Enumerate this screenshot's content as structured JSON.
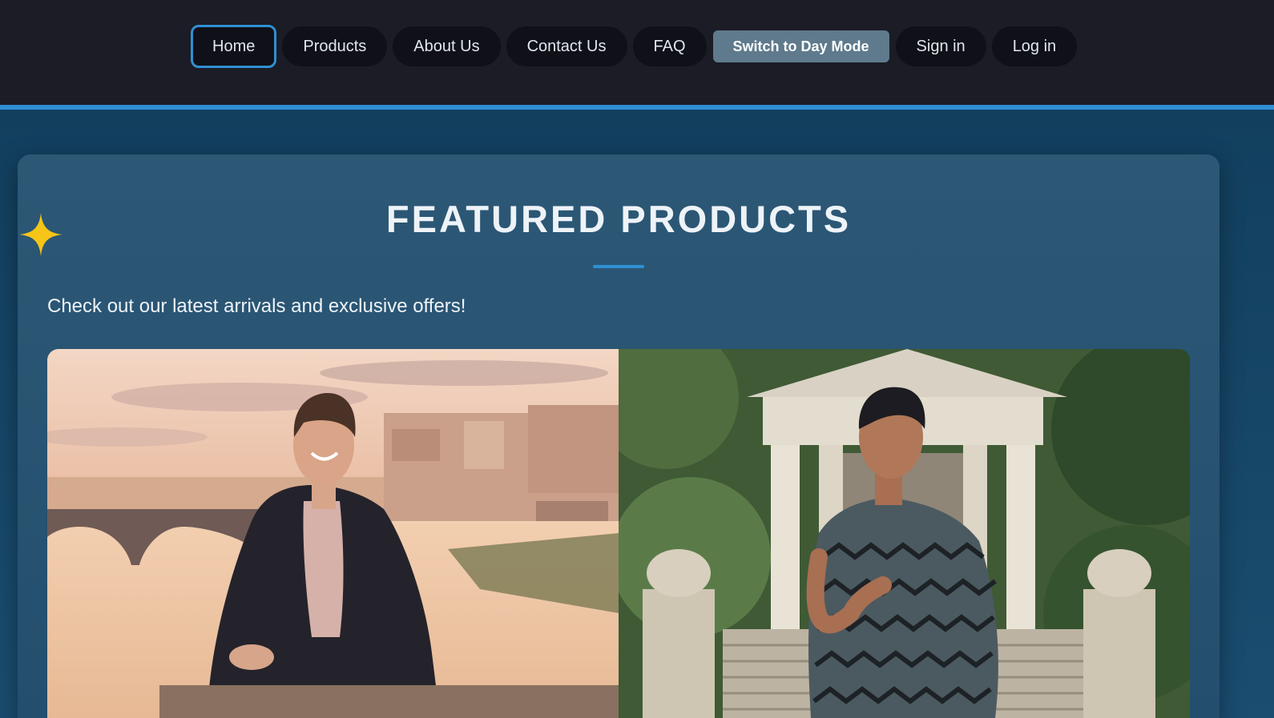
{
  "nav": {
    "items": [
      {
        "label": "Home",
        "name": "nav-home",
        "active": true
      },
      {
        "label": "Products",
        "name": "nav-products"
      },
      {
        "label": "About Us",
        "name": "nav-about-us"
      },
      {
        "label": "Contact Us",
        "name": "nav-contact-us"
      },
      {
        "label": "FAQ",
        "name": "nav-faq"
      }
    ],
    "day_mode_label": "Switch to Day Mode",
    "sign_in_label": "Sign in",
    "log_in_label": "Log in"
  },
  "featured": {
    "title": "FEATURED PRODUCTS",
    "subtitle": "Check out our latest arrivals and exclusive offers!",
    "images": [
      {
        "name": "man-in-black-suit-by-river-photo"
      },
      {
        "name": "man-in-zigzag-shirt-garden-photo"
      }
    ]
  },
  "colors": {
    "header_bg": "#1b1c26",
    "accent": "#2f8fd4",
    "page_bg": "#123f5e",
    "card_bg": "#2c5876",
    "day_mode_button": "#5f7a8c",
    "star": "#f5c518"
  },
  "icons": {
    "decoration": "sparkle-star-icon"
  }
}
